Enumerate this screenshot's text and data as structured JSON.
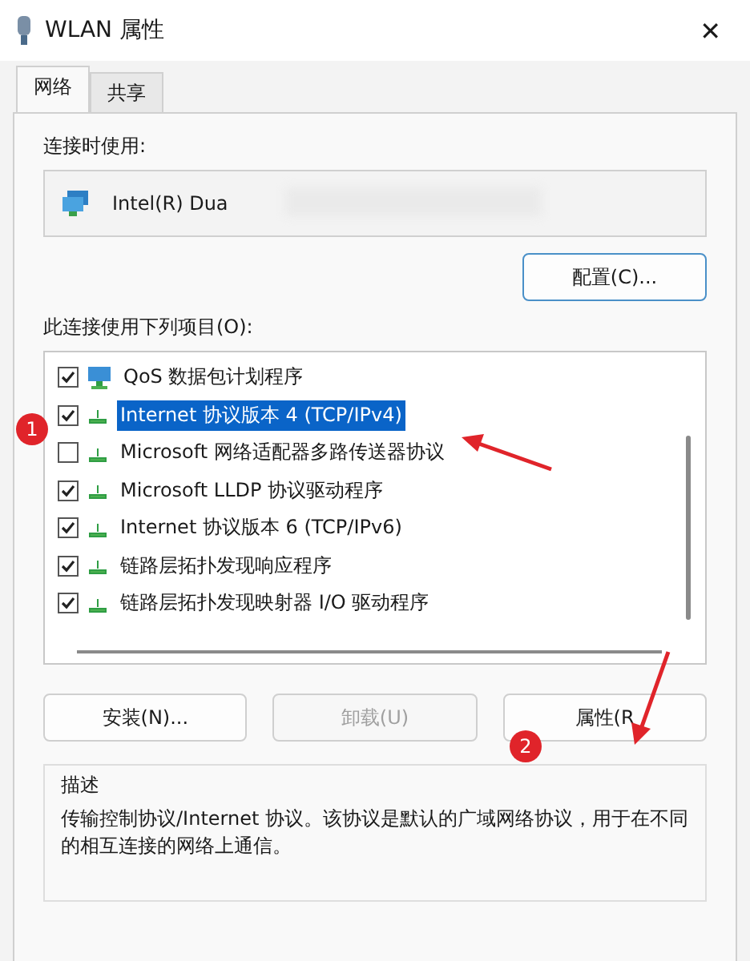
{
  "window": {
    "title": "WLAN 属性",
    "close": "✕"
  },
  "tabs": [
    {
      "label": "网络",
      "selected": true
    },
    {
      "label": "共享",
      "selected": false
    }
  ],
  "connect_using": {
    "label": "连接时使用:",
    "adapter": "Intel(R) Dua"
  },
  "configure_button": "配置(C)...",
  "items_label": "此连接使用下列项目(O):",
  "items": [
    {
      "label": "QoS 数据包计划程序",
      "checked": true,
      "selected": false,
      "kind": "service"
    },
    {
      "label": "Internet 协议版本 4 (TCP/IPv4)",
      "checked": true,
      "selected": true,
      "kind": "protocol"
    },
    {
      "label": "Microsoft 网络适配器多路传送器协议",
      "checked": false,
      "selected": false,
      "kind": "protocol"
    },
    {
      "label": "Microsoft LLDP 协议驱动程序",
      "checked": true,
      "selected": false,
      "kind": "protocol"
    },
    {
      "label": "Internet 协议版本 6 (TCP/IPv6)",
      "checked": true,
      "selected": false,
      "kind": "protocol"
    },
    {
      "label": "链路层拓扑发现响应程序",
      "checked": true,
      "selected": false,
      "kind": "protocol"
    },
    {
      "label": "链路层拓扑发现映射器 I/O 驱动程序",
      "checked": true,
      "selected": false,
      "kind": "protocol"
    }
  ],
  "buttons": [
    {
      "label": "安装(N)...",
      "disabled": false
    },
    {
      "label": "卸载(U)",
      "disabled": true
    },
    {
      "label": "属性(R",
      "disabled": false
    }
  ],
  "description": {
    "label": "描述",
    "text": "传输控制协议/Internet 协议。该协议是默认的广域网络协议，用于在不同的相互连接的网络上通信。"
  },
  "annotations": [
    "1",
    "2"
  ]
}
